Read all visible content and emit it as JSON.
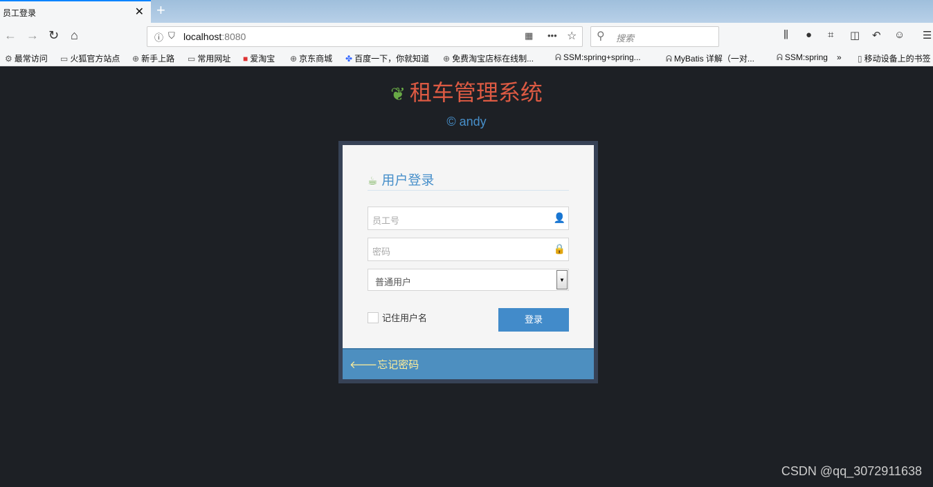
{
  "browser": {
    "tab_title": "员工登录",
    "url_host": "localhost",
    "url_port": ":8080",
    "search_placeholder": "搜索",
    "bookmarks": [
      "最常访问",
      "火狐官方站点",
      "新手上路",
      "常用网址",
      "爱淘宝",
      "京东商城",
      "百度一下，你就知道",
      "免费淘宝店标在线制...",
      "SSM:spring+spring...",
      "MyBatis 详解（一对...",
      "SSM:spring",
      "移动设备上的书签"
    ]
  },
  "page": {
    "title": "租车管理系统",
    "copyright": "© andy",
    "login_heading": "用户登录",
    "username_placeholder": "员工号",
    "password_placeholder": "密码",
    "role_selected": "普通用户",
    "remember_label": "记住用户名",
    "login_button": "登录",
    "forgot_link": "忘记密码"
  },
  "watermark": "CSDN @qq_3072911638",
  "colors": {
    "title": "#dd5a43",
    "accent": "#478fca",
    "button": "#428bca",
    "footer": "#4d8fc0",
    "leaf": "#69aa46"
  }
}
